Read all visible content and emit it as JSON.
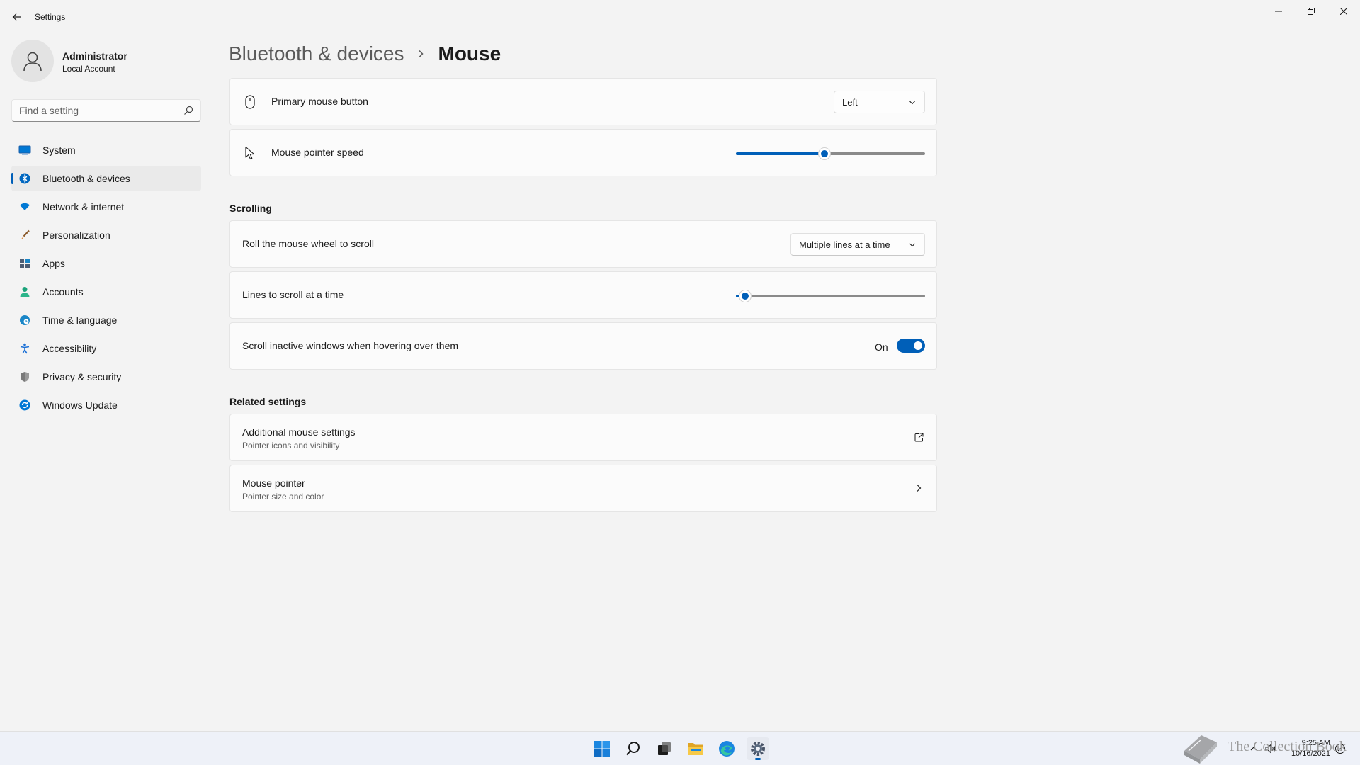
{
  "window": {
    "title": "Settings"
  },
  "profile": {
    "name": "Administrator",
    "account_type": "Local Account"
  },
  "search": {
    "placeholder": "Find a setting"
  },
  "sidebar": {
    "items": [
      {
        "label": "System",
        "icon": "system-icon",
        "color": "#0078d4"
      },
      {
        "label": "Bluetooth & devices",
        "icon": "bluetooth-icon",
        "color": "#0067c0",
        "active": true
      },
      {
        "label": "Network & internet",
        "icon": "wifi-icon",
        "color": "#0078d4"
      },
      {
        "label": "Personalization",
        "icon": "brush-icon",
        "color": "#c77b3b"
      },
      {
        "label": "Apps",
        "icon": "apps-icon",
        "color": "#4d5d73"
      },
      {
        "label": "Accounts",
        "icon": "person-icon",
        "color": "#1aa37a"
      },
      {
        "label": "Time & language",
        "icon": "globe-clock-icon",
        "color": "#1a86c7"
      },
      {
        "label": "Accessibility",
        "icon": "accessibility-icon",
        "color": "#1a6fd6"
      },
      {
        "label": "Privacy & security",
        "icon": "shield-icon",
        "color": "#7a7a7a"
      },
      {
        "label": "Windows Update",
        "icon": "update-icon",
        "color": "#0078d4"
      }
    ]
  },
  "breadcrumb": {
    "parent": "Bluetooth & devices",
    "current": "Mouse"
  },
  "settings": {
    "primary_button": {
      "label": "Primary mouse button",
      "value": "Left"
    },
    "pointer_speed": {
      "label": "Mouse pointer speed",
      "value_fraction": 0.47
    },
    "scrolling_title": "Scrolling",
    "wheel_scroll": {
      "label": "Roll the mouse wheel to scroll",
      "value": "Multiple lines at a time"
    },
    "lines_to_scroll": {
      "label": "Lines to scroll at a time",
      "value_fraction": 0.05
    },
    "inactive_scroll": {
      "label": "Scroll inactive windows when hovering over them",
      "state_label": "On",
      "enabled": true
    }
  },
  "related": {
    "title": "Related settings",
    "items": [
      {
        "title": "Additional mouse settings",
        "subtitle": "Pointer icons and visibility",
        "icon": "open-external-icon"
      },
      {
        "title": "Mouse pointer",
        "subtitle": "Pointer size and color",
        "icon": "chevron-right-icon"
      }
    ]
  },
  "taskbar": {
    "apps": [
      "start-icon",
      "search-icon",
      "task-view-icon",
      "file-explorer-icon",
      "edge-icon",
      "settings-icon"
    ],
    "time": "9:25 AM",
    "date": "10/16/2021",
    "watermark": "The Collection Book"
  },
  "colors": {
    "accent": "#005fb8",
    "background": "#f3f3f3",
    "card": "#fbfbfb"
  }
}
